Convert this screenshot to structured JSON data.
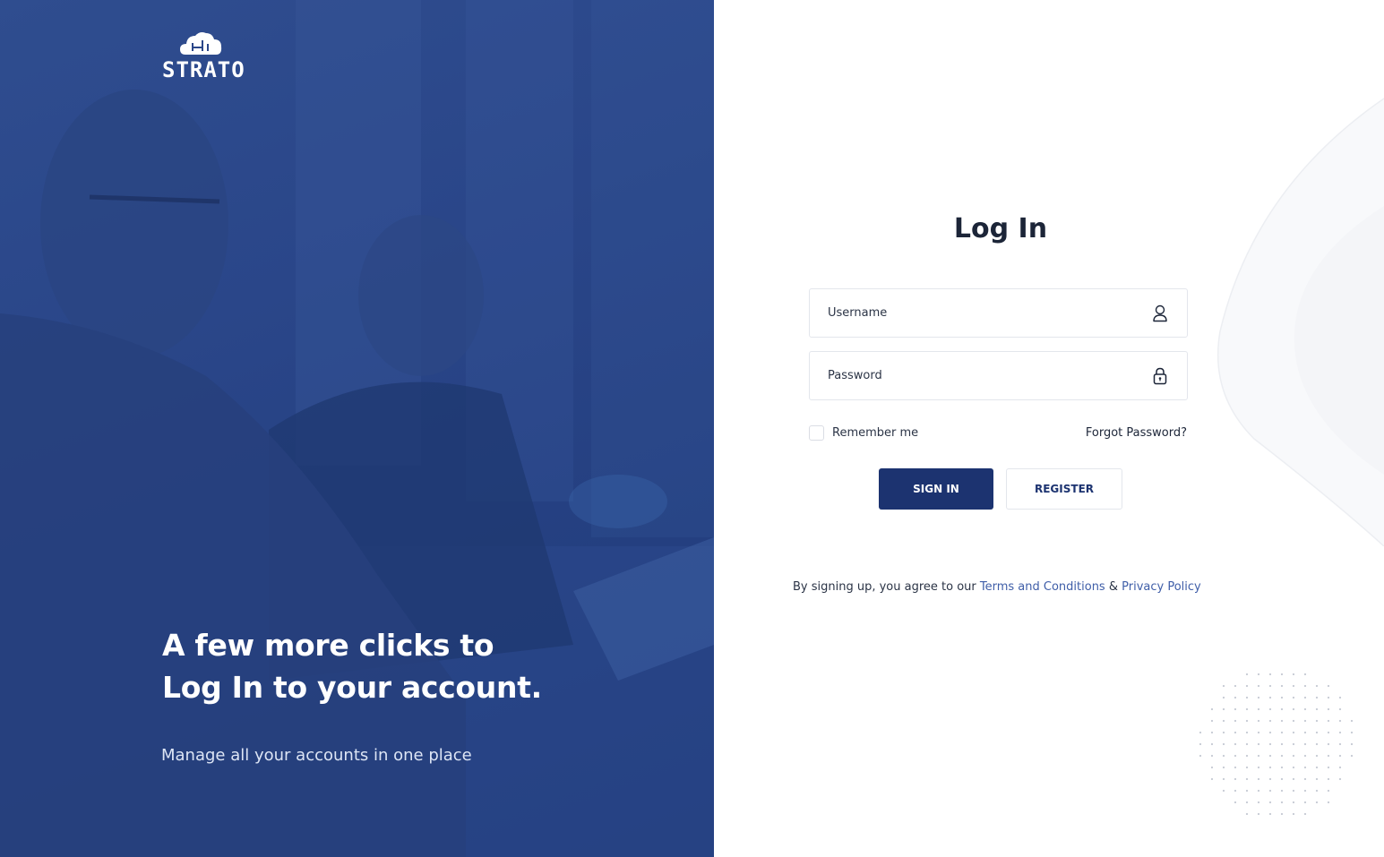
{
  "brand": {
    "name": "STRATO"
  },
  "hero": {
    "headline_line1": "A few more clicks to",
    "headline_line2": "Log In to your account.",
    "subtitle": "Manage all your accounts in one place"
  },
  "form": {
    "title": "Log In",
    "username_placeholder": "Username",
    "password_placeholder": "Password",
    "remember_label": "Remember me",
    "remember_checked": false,
    "forgot_label": "Forgot Password?",
    "signin_label": "SIGN IN",
    "register_label": "REGISTER"
  },
  "footer": {
    "prefix": "By signing up, you agree to our ",
    "terms_link": "Terms and Conditions",
    "amp": " & ",
    "privacy_link": "Privacy Policy"
  },
  "colors": {
    "hero_blue": "#2a4689",
    "primary": "#1c3370",
    "link": "#3f5ea8",
    "text": "#1c2538"
  },
  "icons": [
    "cloud-logo-icon",
    "user-icon",
    "lock-icon"
  ]
}
